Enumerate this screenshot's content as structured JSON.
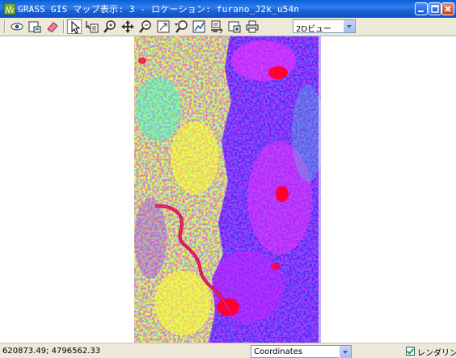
{
  "window": {
    "title": "GRASS GIS マップ表示: 3  - ロケーション: furano_J2k_u54n"
  },
  "toolbar": {
    "tools": [
      {
        "name": "display-icon"
      },
      {
        "name": "render-icon"
      },
      {
        "name": "erase-icon"
      },
      {
        "name": "pointer-icon"
      },
      {
        "name": "query-icon"
      },
      {
        "name": "zoom-in-icon"
      },
      {
        "name": "pan-icon"
      },
      {
        "name": "zoom-out-icon"
      },
      {
        "name": "zoom-back-icon"
      },
      {
        "name": "zoom-menu-icon"
      },
      {
        "name": "analyze-icon"
      },
      {
        "name": "overlay-icon"
      },
      {
        "name": "save-icon"
      },
      {
        "name": "print-icon"
      }
    ],
    "view_mode": "2Dビュー"
  },
  "raster": {
    "colors": [
      "#ffff33",
      "#ccff33",
      "#33ffcc",
      "#3333ff",
      "#ff33ff",
      "#ff0033",
      "#66ff66",
      "#9933ff"
    ]
  },
  "statusbar": {
    "coordinates": "620873.49; 4796562.33",
    "mode": "Coordinates",
    "render_label": "レンダリング",
    "render_checked": true
  }
}
